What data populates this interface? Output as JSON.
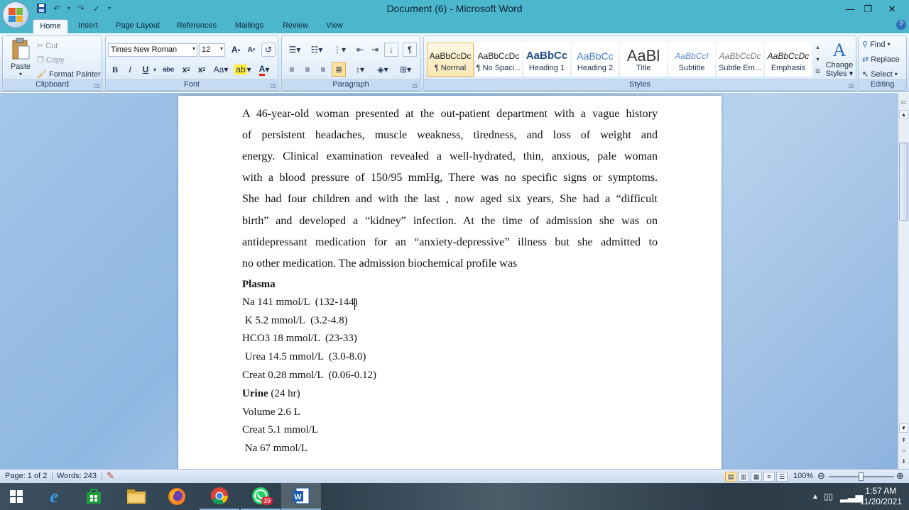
{
  "window": {
    "title": "Document (6) - Microsoft Word"
  },
  "tabs": [
    "Home",
    "Insert",
    "Page Layout",
    "References",
    "Mailings",
    "Review",
    "View"
  ],
  "clipboard": {
    "paste": "Paste",
    "cut": "Cut",
    "copy": "Copy",
    "format_painter": "Format Painter",
    "label": "Clipboard"
  },
  "font": {
    "name": "Times New Roman",
    "size": "12",
    "label": "Font"
  },
  "paragraph": {
    "label": "Paragraph"
  },
  "styles": {
    "label": "Styles",
    "items": [
      {
        "preview": "AaBbCcDc",
        "name": "¶ Normal"
      },
      {
        "preview": "AaBbCcDc",
        "name": "¶ No Spaci..."
      },
      {
        "preview": "AaBbCc",
        "name": "Heading 1"
      },
      {
        "preview": "AaBbCc",
        "name": "Heading 2"
      },
      {
        "preview": "AaBl",
        "name": "Title"
      },
      {
        "preview": "AaBbCcI",
        "name": "Subtitle"
      },
      {
        "preview": "AaBbCcDc",
        "name": "Subtle Em..."
      },
      {
        "preview": "AaBbCcDc",
        "name": "Emphasis"
      }
    ],
    "change_styles": [
      "Change",
      "Styles"
    ]
  },
  "editing": {
    "find": "Find",
    "replace": "Replace",
    "select": "Select",
    "label": "Editing"
  },
  "document": {
    "paragraph_lines": [
      "A 46-year-old woman presented at the out-patient department with a vague history",
      "of persistent headaches, muscle weakness, tiredness, and loss of weight and",
      "energy. Clinical examination revealed a well-hydrated, thin, anxious, pale woman",
      "with a blood pressure of 150/95 mmHg, There was no specific signs or symptoms.",
      "She had four children and with the last , now aged six years, She had a “difficult",
      "birth” and developed a “kidney” infection. At the time of admission she was on",
      "antidepressant medication for an “anxiety-depressive” illness but she admitted to"
    ],
    "paragraph_last_line": "no other medication. The admission biochemical profile was",
    "plasma_heading": "Plasma",
    "plasma_lines": [
      "Na 141 mmol/L  (132-144)",
      " K 5.2 mmol/L  (3.2-4.8)",
      "HCO3 18 mmol/L  (23-33)",
      " Urea 14.5 mmol/L  (3.0-8.0)",
      "Creat 0.28 mmol/L  (0.06-0.12)"
    ],
    "urine_heading": "Urine",
    "urine_suffix": " (24 hr)",
    "urine_lines": [
      "Volume 2.6 L",
      "Creat 5.1 mmol/L",
      " Na 67 mmol/L"
    ]
  },
  "status": {
    "page": "Page: 1 of 2",
    "words": "Words: 243",
    "zoom": "100%",
    "zoom_level": 1.0
  },
  "taskbar": {
    "whatsapp_badge": "39",
    "time": "1:57 AM",
    "date": "11/20/2021"
  },
  "colors": {
    "titlebar": "#4cb6cc",
    "ribbon": "#dbe8f5",
    "accent": "#f2b24a"
  }
}
